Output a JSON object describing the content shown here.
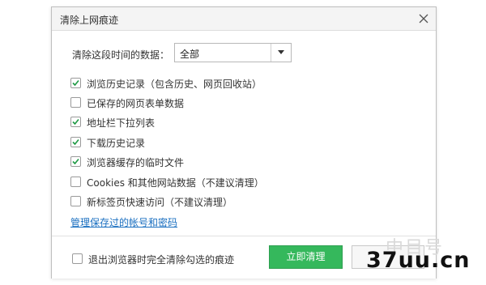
{
  "dialog": {
    "title": "清除上网痕迹",
    "range_label": "清除这段时间的数据：",
    "range_value": "全部",
    "options": [
      {
        "label": "浏览历史记录（包含历史、网页回收站）",
        "checked": true
      },
      {
        "label": "已保存的网页表单数据",
        "checked": false
      },
      {
        "label": "地址栏下拉列表",
        "checked": true
      },
      {
        "label": "下载历史记录",
        "checked": true
      },
      {
        "label": "浏览器缓存的临时文件",
        "checked": true
      },
      {
        "label": "Cookies 和其他网站数据（不建议清理）",
        "checked": false
      },
      {
        "label": "新标签页快速访问（不建议清理）",
        "checked": false
      }
    ],
    "manage_link": "管理保存过的帐号和密码",
    "footer_checkbox": {
      "label": "退出浏览器时完全清除勾选的痕迹",
      "checked": false
    },
    "primary_button": "立即清理",
    "secondary_button": ""
  },
  "watermark": {
    "faint_text": "中目号",
    "text": "37uu.cn"
  },
  "colors": {
    "accent_green": "#35b85c",
    "link_blue": "#1a6fc0",
    "title_bar": "#f4f4f4"
  },
  "icons": {
    "close": "close-icon",
    "dropdown": "chevron-down-icon",
    "check": "checkmark-icon"
  }
}
